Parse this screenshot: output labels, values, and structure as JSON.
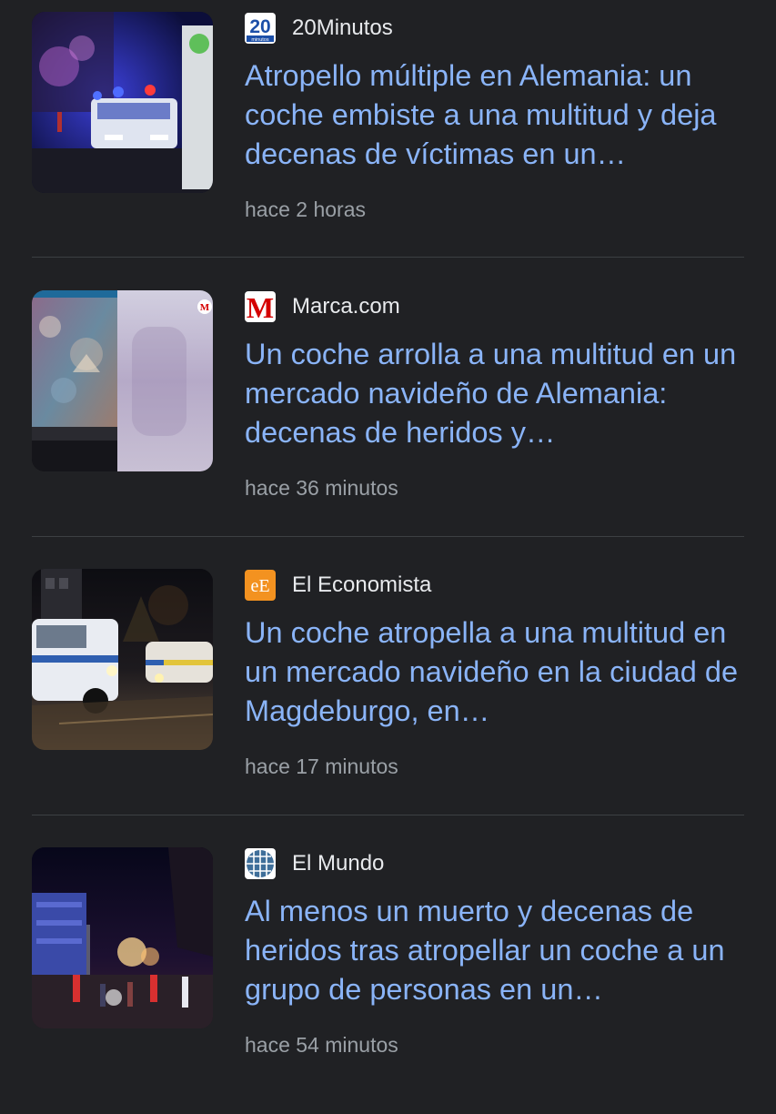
{
  "articles": [
    {
      "source": "20Minutos",
      "source_icon": "20minutos-logo-icon",
      "title": "Atropello múltiple en Alemania: un coche embiste a una multitud y deja decenas de víctimas en un…",
      "time": "hace 2 horas",
      "logo_text": "20",
      "logo_subtext": "minutos"
    },
    {
      "source": "Marca.com",
      "source_icon": "marca-logo-icon",
      "title": "Un coche arrolla a una multitud en un mercado navideño de Alemania: decenas de heridos y…",
      "time": "hace 36 minutos",
      "logo_text": "M"
    },
    {
      "source": "El Economista",
      "source_icon": "eleconomista-logo-icon",
      "title": "Un coche atropella a una multitud en un mercado navideño en la ciudad de Magdeburgo, en…",
      "time": "hace 17 minutos",
      "logo_text": "eE"
    },
    {
      "source": "El Mundo",
      "source_icon": "elmundo-logo-icon",
      "title": "Al menos un muerto y decenas de heridos tras atropellar un coche a un grupo de personas en un…",
      "time": "hace 54 minutos"
    }
  ],
  "colors": {
    "background": "#202124",
    "headline": "#8ab4f8",
    "source": "#e8eaed",
    "timestamp": "#9aa0a6",
    "divider": "#3c4043"
  }
}
